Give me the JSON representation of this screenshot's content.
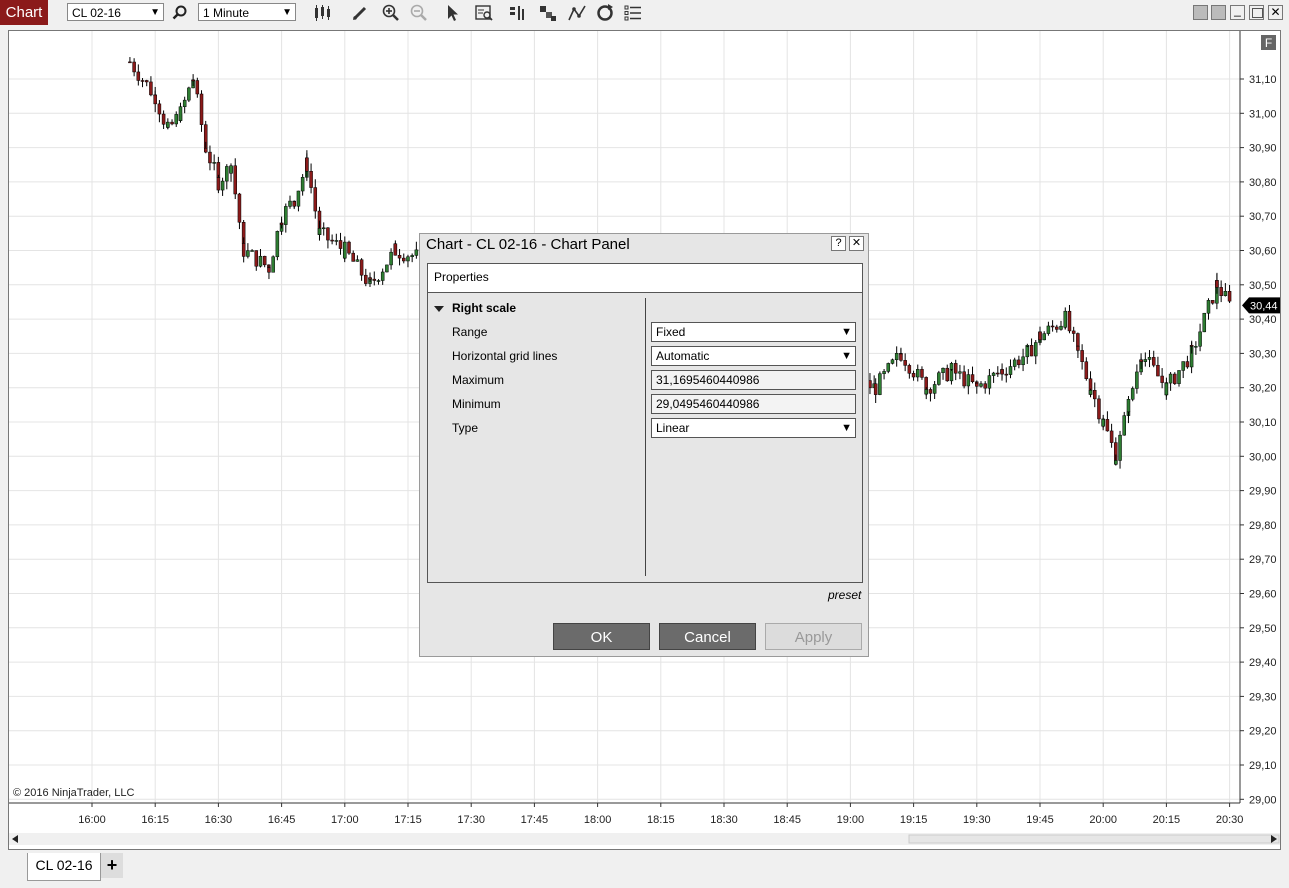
{
  "toolbar": {
    "chart_tab": "Chart",
    "instrument": "CL 02-16",
    "interval": "1 Minute"
  },
  "chart": {
    "copyright": "© 2016 NinjaTrader, LLC",
    "f_badge": "F",
    "current_price": "30,44",
    "price_ticks": [
      "31,10",
      "31,00",
      "30,90",
      "30,80",
      "30,70",
      "30,60",
      "30,50",
      "30,40",
      "30,30",
      "30,20",
      "30,10",
      "30,00",
      "29,90",
      "29,80",
      "29,70",
      "29,60",
      "29,50",
      "29,40",
      "29,30",
      "29,20",
      "29,10",
      "29,00"
    ],
    "time_ticks": [
      "16:00",
      "16:15",
      "16:30",
      "16:45",
      "17:00",
      "17:15",
      "17:30",
      "17:45",
      "18:00",
      "18:15",
      "18:30",
      "18:45",
      "19:00",
      "19:15",
      "19:30",
      "19:45",
      "20:00",
      "20:15",
      "20:30"
    ]
  },
  "chart_data": {
    "type": "candlestick",
    "ylim": [
      29.0,
      31.15
    ],
    "close_path": [
      [
        16.15,
        31.15
      ],
      [
        16.25,
        31.05
      ],
      [
        16.3,
        30.95
      ],
      [
        16.35,
        31.0
      ],
      [
        16.4,
        31.1
      ],
      [
        16.45,
        30.9
      ],
      [
        16.5,
        30.8
      ],
      [
        16.55,
        30.85
      ],
      [
        16.6,
        30.6
      ],
      [
        16.7,
        30.55
      ],
      [
        16.75,
        30.7
      ],
      [
        16.8,
        30.75
      ],
      [
        16.85,
        30.85
      ],
      [
        16.9,
        30.65
      ],
      [
        17.0,
        30.6
      ],
      [
        17.1,
        30.5
      ],
      [
        17.2,
        30.6
      ],
      [
        19.1,
        30.2
      ],
      [
        19.2,
        30.3
      ],
      [
        19.3,
        30.2
      ],
      [
        19.4,
        30.25
      ],
      [
        19.5,
        30.2
      ],
      [
        19.6,
        30.25
      ],
      [
        19.7,
        30.3
      ],
      [
        19.75,
        30.35
      ],
      [
        19.85,
        30.4
      ],
      [
        19.9,
        30.3
      ],
      [
        19.95,
        30.2
      ],
      [
        20.0,
        30.1
      ],
      [
        20.05,
        30.0
      ],
      [
        20.1,
        30.15
      ],
      [
        20.15,
        30.3
      ],
      [
        20.25,
        30.2
      ],
      [
        20.35,
        30.3
      ],
      [
        20.45,
        30.5
      ],
      [
        20.5,
        30.44
      ]
    ]
  },
  "dialog": {
    "title": "Chart - CL 02-16 - Chart Panel",
    "help": "?",
    "close": "✕",
    "properties_header": "Properties",
    "section": "Right scale",
    "rows": [
      {
        "label": "Range",
        "value": "Fixed"
      },
      {
        "label": "Horizontal grid lines",
        "value": "Automatic"
      },
      {
        "label": "Maximum",
        "value": "31,1695460440986"
      },
      {
        "label": "Minimum",
        "value": "29,0495460440986"
      },
      {
        "label": "Type",
        "value": "Linear"
      }
    ],
    "preset": "preset",
    "ok": "OK",
    "cancel": "Cancel",
    "apply": "Apply"
  },
  "tabs": {
    "active": "CL 02-16",
    "add": "+"
  }
}
